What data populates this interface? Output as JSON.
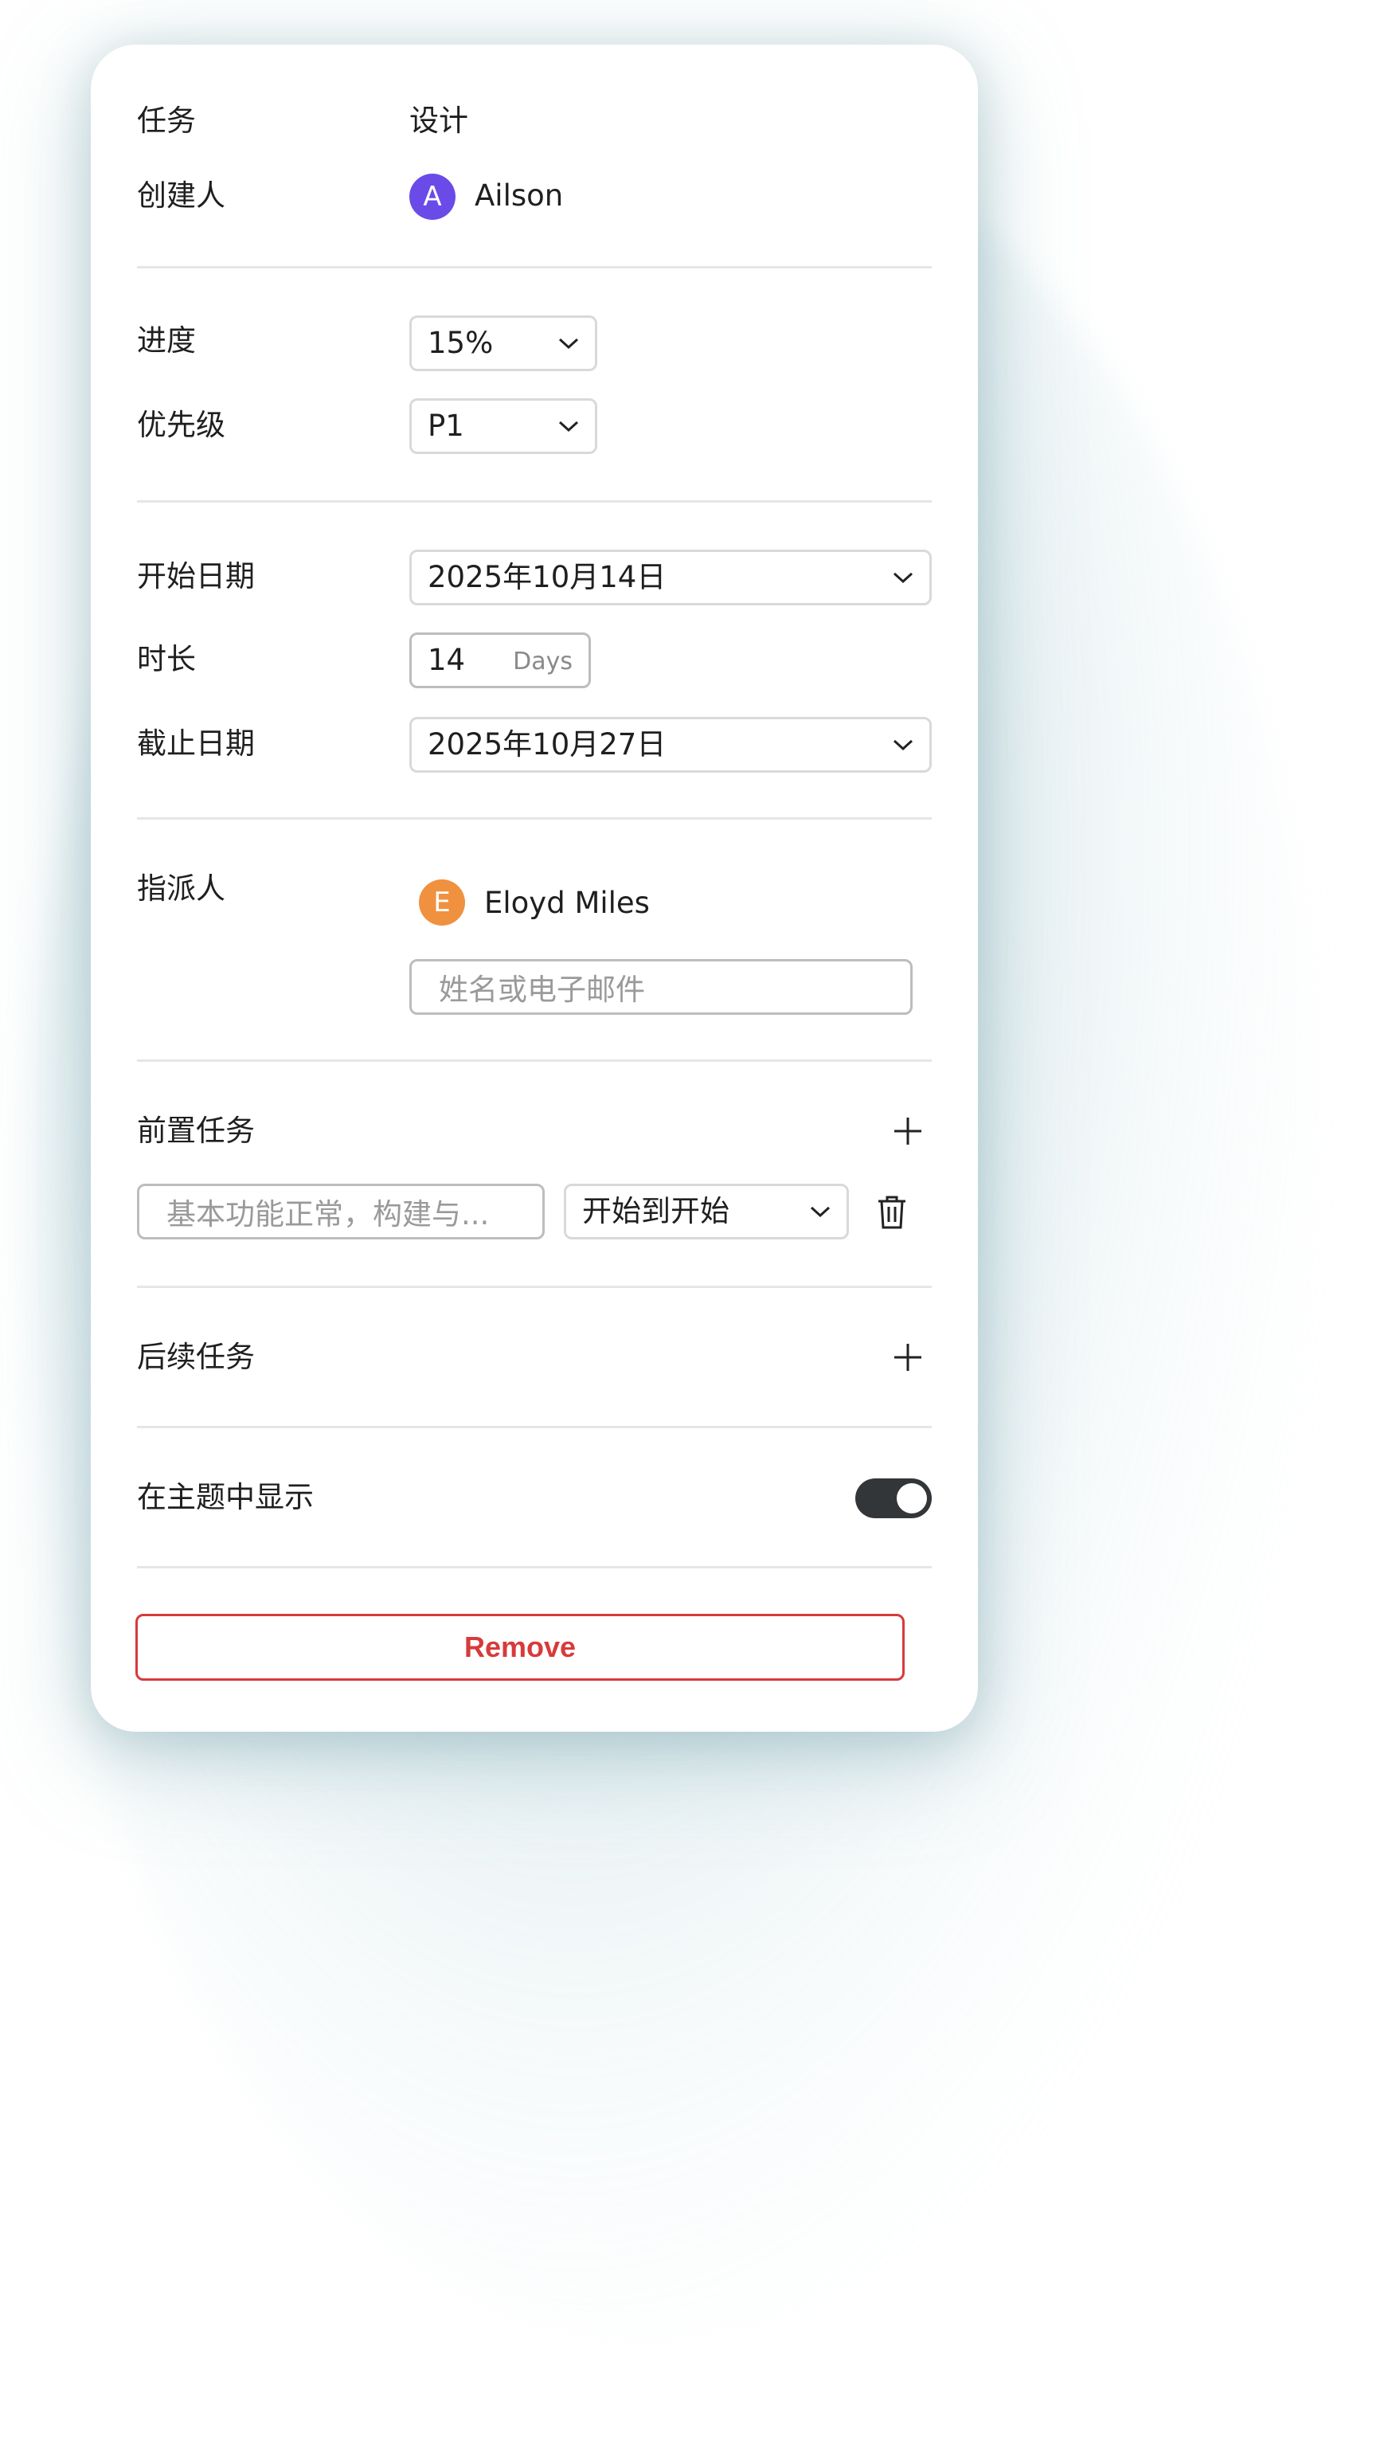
{
  "task": {
    "label": "任务",
    "value": "设计"
  },
  "creator": {
    "label": "创建人",
    "avatar_initial": "A",
    "avatar_color": "#6a4be8",
    "name": "Ailson"
  },
  "progress": {
    "label": "进度",
    "value": "15%"
  },
  "priority": {
    "label": "优先级",
    "value": "P1"
  },
  "start_date": {
    "label": "开始日期",
    "value": "2025年10月14日"
  },
  "duration": {
    "label": "时长",
    "value": "14",
    "unit": "Days"
  },
  "due_date": {
    "label": "截止日期",
    "value": "2025年10月27日"
  },
  "assignee": {
    "label": "指派人",
    "avatar_initial": "E",
    "avatar_color": "#f0913f",
    "name": "Eloyd Miles",
    "input_placeholder": "姓名或电子邮件"
  },
  "predecessors": {
    "label": "前置任务",
    "task_placeholder": "基本功能正常，构建与...",
    "relation": "开始到开始"
  },
  "successors": {
    "label": "后续任务"
  },
  "show_in_theme": {
    "label": "在主题中显示",
    "enabled": true
  },
  "remove_button": {
    "label": "Remove",
    "color": "#d83a3a"
  },
  "icons": {
    "add": "plus-icon",
    "delete": "trash-icon",
    "dropdown": "chevron-down-icon"
  }
}
